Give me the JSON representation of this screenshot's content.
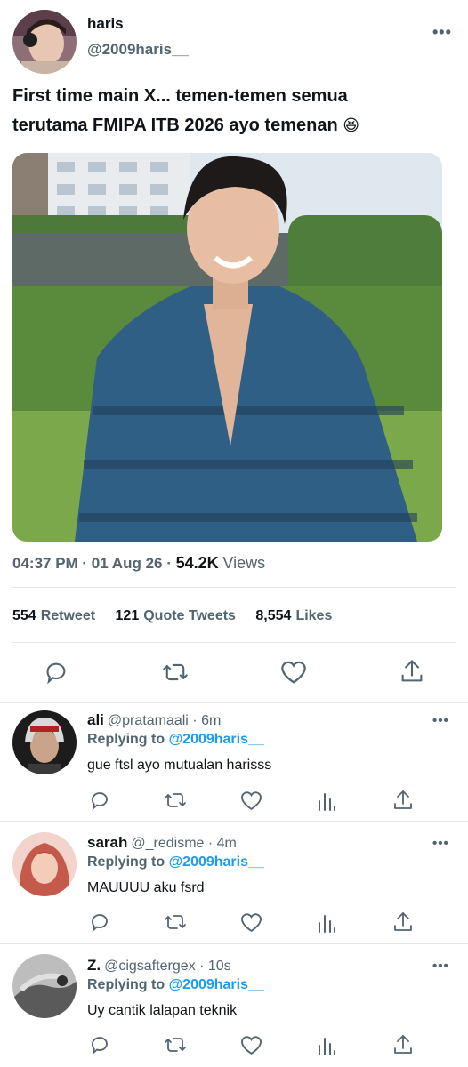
{
  "tweet": {
    "author_name": "haris",
    "author_handle": "@2009haris__",
    "text_line1": "First time main X... temen-temen semua",
    "text_line2": "terutama FMIPA ITB 2026 ayo temenan",
    "emoji": "😆",
    "time": "04:37 PM · 01 Aug 26 ·",
    "views_count": "54.2K",
    "views_label": "Views",
    "retweets_count": "554",
    "retweets_label": "Retweet",
    "quotes_count": "121",
    "quotes_label": "Quote Tweets",
    "likes_count": "8,554",
    "likes_label": "Likes"
  },
  "replies": [
    {
      "name": "ali",
      "handle": "@pratamaali",
      "time": "· 6m",
      "replying_prefix": "Replying to",
      "replying_to": "@2009haris__",
      "text": "gue ftsl ayo mutualan harisss"
    },
    {
      "name": "sarah",
      "handle": "@_redisme",
      "time": "· 4m",
      "replying_prefix": "Replying to",
      "replying_to": "@2009haris__",
      "text": "MAUUUU aku fsrd"
    },
    {
      "name": "Z.",
      "handle": "@cigsaftergex",
      "time": "· 10s",
      "replying_prefix": "Replying to",
      "replying_to": "@2009haris__",
      "text": "Uy cantik lalapan teknik"
    }
  ],
  "more_label": "•••",
  "icons": [
    "reply-icon",
    "retweet-icon",
    "like-icon",
    "share-icon",
    "analytics-icon",
    "more-icon"
  ],
  "colors": {
    "accent": "#1d9bf0",
    "secondary_text": "#536471",
    "divider": "#e6e6e6"
  }
}
